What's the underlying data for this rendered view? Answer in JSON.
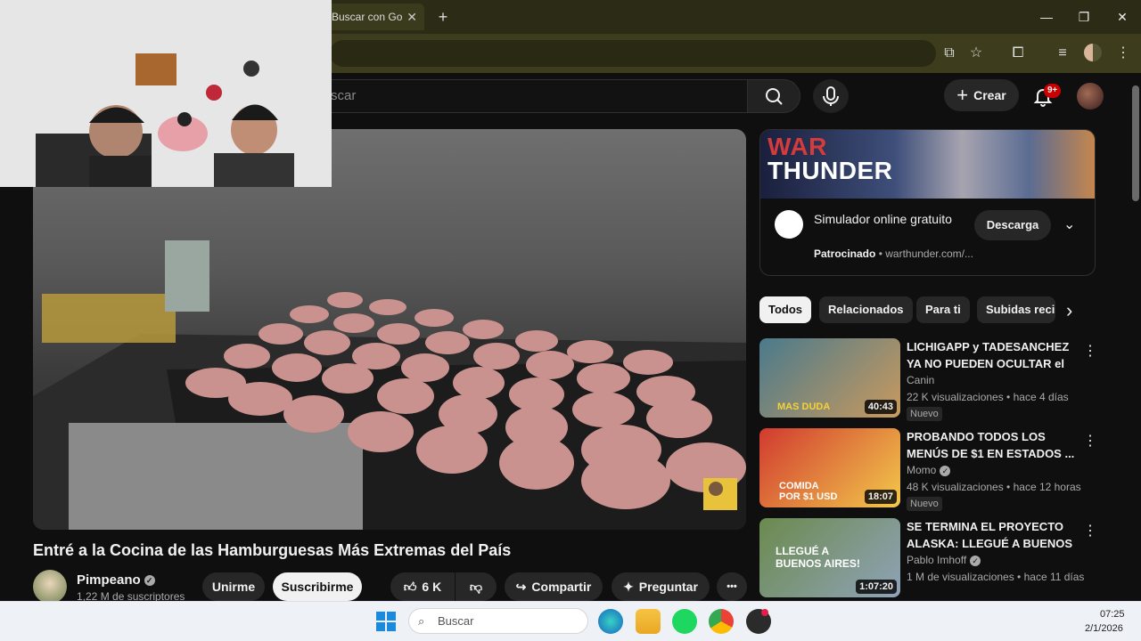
{
  "browser": {
    "tab_title": "Buscar con Go",
    "tab_close": "✕",
    "new_tab": "+",
    "minimize": "—",
    "maximize": "❐",
    "close": "✕"
  },
  "header": {
    "search_placeholder": "scar",
    "create_label": "Crear",
    "notifications_count": "9+"
  },
  "video": {
    "title": "Entré a la Cocina de las Hamburguesas Más Extremas del País",
    "channel": "Pimpeano",
    "subscribers": "1,22 M de suscriptores",
    "join_label": "Unirme",
    "subscribe_label": "Suscribirme",
    "likes": "6 K",
    "share_label": "Compartir",
    "ask_label": "Preguntar",
    "more_label": "•••"
  },
  "ad": {
    "logo_top": "WAR",
    "logo_bottom": "THUNDER",
    "title": "Simulador online gratuito",
    "sponsored": "Patrocinado",
    "domain": "warthunder.com/...",
    "cta": "Descarga"
  },
  "chips": [
    "Todos",
    "Relacionados",
    "Para ti",
    "Subidas reci"
  ],
  "recommendations": [
    {
      "title": "LICHIGAPP y TADESANCHEZ YA NO PUEDEN OCULTAR el ...",
      "channel": "Canin",
      "verified": false,
      "meta": "22 K visualizaciones • hace 4 días",
      "badge": "Nuevo",
      "duration": "40:43",
      "thumb_caption": "MAS DUDA",
      "thumb_colors": [
        "#4a7a8c",
        "#c99a5e"
      ]
    },
    {
      "title": "PROBANDO TODOS LOS MENÚS DE $1 EN ESTADOS ...",
      "channel": "Momo",
      "verified": true,
      "meta": "48 K visualizaciones • hace 12 horas",
      "badge": "Nuevo",
      "duration": "18:07",
      "thumb_caption": "COMIDA POR $1 USD",
      "thumb_colors": [
        "#d13a2f",
        "#f2c94c"
      ]
    },
    {
      "title": "SE TERMINA EL PROYECTO ALASKA: LLEGUÉ A BUENOS ...",
      "channel": "Pablo Imhoff",
      "verified": true,
      "meta": "1 M de visualizaciones • hace 11 días",
      "badge": "",
      "duration": "1:07:20",
      "thumb_caption": "LLEGUÉ A BUENOS AIRES!",
      "thumb_colors": [
        "#6b8a4e",
        "#8fa3b8"
      ]
    }
  ],
  "taskbar": {
    "search_label": "Buscar",
    "time": "07:25",
    "date": "2/1/2026"
  }
}
